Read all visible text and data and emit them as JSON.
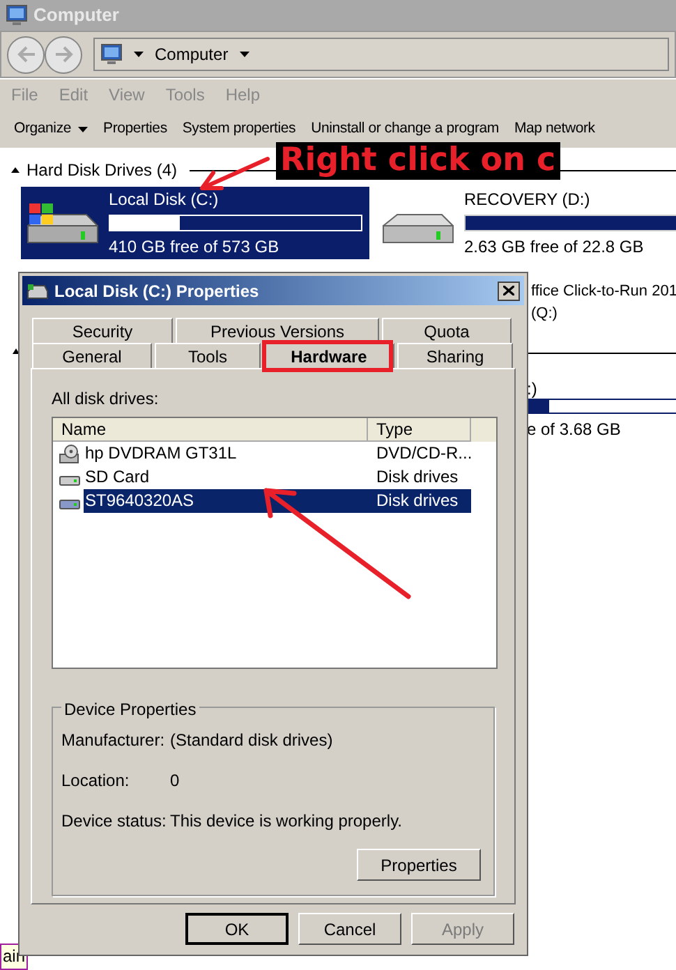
{
  "explorer": {
    "title": "Computer",
    "address": "Computer",
    "menu": [
      "File",
      "Edit",
      "View",
      "Tools",
      "Help"
    ],
    "toolbar": [
      {
        "label": "Organize",
        "dropdown": true
      },
      {
        "label": "Properties",
        "dropdown": false
      },
      {
        "label": "System properties",
        "dropdown": false
      },
      {
        "label": "Uninstall or change a program",
        "dropdown": false
      },
      {
        "label": "Map network",
        "dropdown": false
      }
    ],
    "section": {
      "title": "Hard Disk Drives (4)",
      "expanded": true
    },
    "drives": [
      {
        "name": "Local Disk (C:)",
        "free": "410 GB free of 573 GB",
        "level": 0.28,
        "selected": true,
        "kind": "system"
      },
      {
        "name": "RECOVERY (D:)",
        "free": "2.63 GB free of 22.8 GB",
        "level": 0.89,
        "selected": false,
        "kind": "plain"
      }
    ],
    "partly_hidden": {
      "drive_3_lines": [
        "ffice Click-to-Run 201",
        "(Q:)"
      ],
      "drive_4_name": ":)",
      "drive_4_free": "e of 3.68 GB"
    },
    "tooltip": "ain"
  },
  "dialog": {
    "title": "Local Disk (C:) Properties",
    "tab_rows": [
      [
        {
          "label": "Security",
          "selected": false
        },
        {
          "label": "Previous Versions",
          "selected": false
        },
        {
          "label": "Quota",
          "selected": false
        }
      ],
      [
        {
          "label": "General",
          "selected": false
        },
        {
          "label": "Tools",
          "selected": false
        },
        {
          "label": "Hardware",
          "selected": true
        },
        {
          "label": "Sharing",
          "selected": false
        }
      ]
    ],
    "list_label": "All disk drives:",
    "columns": [
      "Name",
      "Type"
    ],
    "rows": [
      {
        "name": "hp DVDRAM GT31L",
        "type": "DVD/CD-R...",
        "kind": "optical",
        "selected": false
      },
      {
        "name": "SD Card",
        "type": "Disk drives",
        "kind": "disk",
        "selected": false
      },
      {
        "name": "ST9640320AS",
        "type": "Disk drives",
        "kind": "disk",
        "selected": true
      }
    ],
    "group": {
      "title": "Device Properties",
      "fields": [
        {
          "label": "Manufacturer:",
          "value": "(Standard disk drives)"
        },
        {
          "label": "Location:",
          "value": "0"
        },
        {
          "label": "Device status:",
          "value": "This device is working properly."
        }
      ],
      "button": "Properties"
    },
    "buttons": [
      {
        "label": "OK",
        "default": true,
        "disabled": false
      },
      {
        "label": "Cancel",
        "default": false,
        "disabled": false
      },
      {
        "label": "Apply",
        "default": false,
        "disabled": true
      }
    ]
  },
  "annotation": {
    "callout": "Right click on c"
  }
}
